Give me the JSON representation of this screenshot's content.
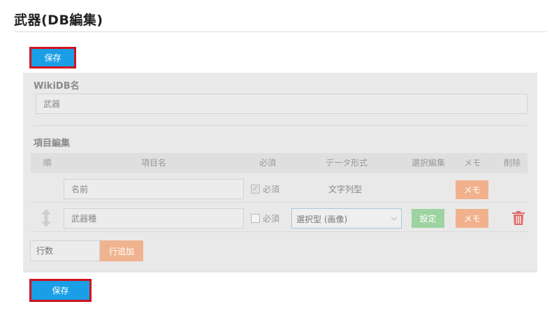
{
  "page": {
    "title": "武器(DB編集)"
  },
  "toolbar": {
    "save_label": "保存"
  },
  "footer": {
    "save_label": "保存"
  },
  "wikidb": {
    "label": "WikiDB名",
    "name_value": "武器"
  },
  "fields": {
    "section_label": "項目編集",
    "columns": [
      "順",
      "項目名",
      "必須",
      "データ形式",
      "選択編集",
      "メモ",
      "削除"
    ],
    "rows": [
      {
        "name": "名前",
        "required_label": "必須",
        "required": true,
        "type": "文字列型",
        "memo_label": "メモ"
      },
      {
        "name": "武器種",
        "required_label": "必須",
        "required": false,
        "type": "選択型 (画像)",
        "set_label": "設定",
        "memo_label": "メモ"
      }
    ]
  },
  "add_row": {
    "placeholder": "行数",
    "button_label": "行追加"
  },
  "colors": {
    "primary": "#1a9fe6",
    "highlight_border": "#d0121f",
    "memo": "#f2b18d",
    "set": "#9dd3a0",
    "delete": "#e06a6a"
  },
  "icons": {
    "drag": "drag-handle-icon",
    "delete": "trash-icon"
  }
}
